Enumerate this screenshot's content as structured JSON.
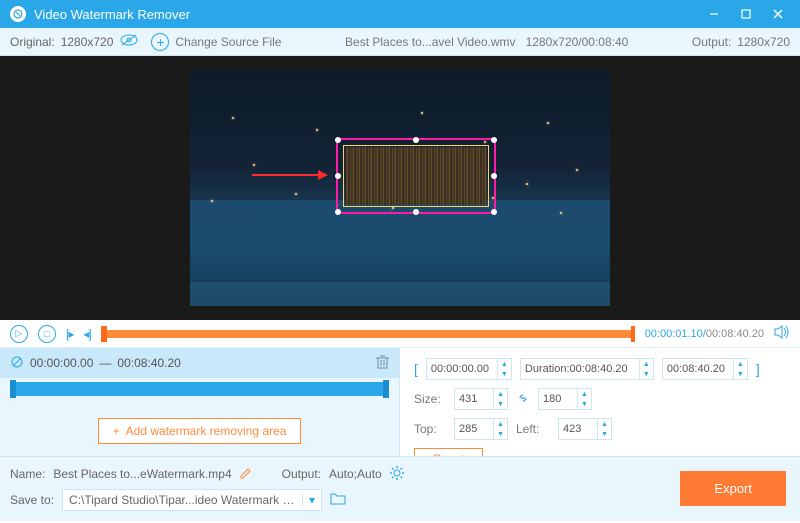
{
  "titlebar": {
    "title": "Video Watermark Remover"
  },
  "toolbar": {
    "original_label": "Original:",
    "original_res": "1280x720",
    "change_source": "Change Source File",
    "filename": "Best Places to...avel Video.wmv",
    "file_res_time": "1280x720/00:08:40",
    "output_label": "Output:",
    "output_res": "1280x720"
  },
  "playback": {
    "current": "00:00:01.10",
    "total": "00:08:40.20"
  },
  "segment": {
    "start": "00:00:00.00",
    "sep": "—",
    "end": "00:08:40.20"
  },
  "add_area_label": "Add watermark removing area",
  "times": {
    "start": "00:00:00.00",
    "duration_label": "Duration:",
    "duration": "00:08:40.20",
    "end": "00:08:40.20"
  },
  "size": {
    "label": "Size:",
    "w": "431",
    "h": "180"
  },
  "pos": {
    "top_label": "Top:",
    "top": "285",
    "left_label": "Left:",
    "left": "423"
  },
  "reset_label": "Reset",
  "bottom": {
    "name_label": "Name:",
    "name_value": "Best Places to...eWatermark.mp4",
    "output_label": "Output:",
    "output_value": "Auto;Auto",
    "save_label": "Save to:",
    "save_path": "C:\\Tipard Studio\\Tipar...ideo Watermark Remover",
    "export": "Export"
  }
}
